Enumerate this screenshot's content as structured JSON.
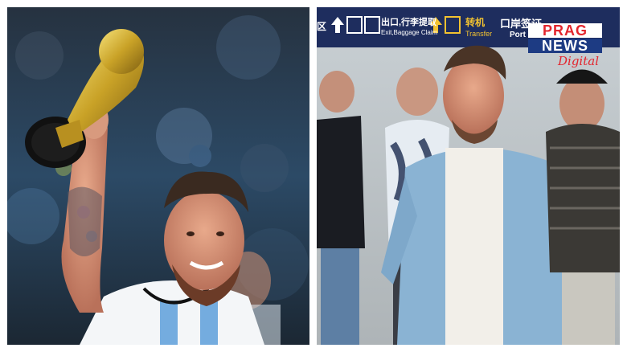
{
  "left_photo": {
    "subject": "player-raising-trophy"
  },
  "right_photo": {
    "signage": {
      "exit_label_cn": "出口,行李提取",
      "exit_label_en": "Exit,Baggage Claim",
      "transfer_label_cn": "转机",
      "transfer_label_en": "Transfer",
      "port_label_cn": "口岸签证",
      "port_label_en": "Port Visa",
      "left_edge_label": "区"
    }
  },
  "watermark": {
    "line1": "PRAG",
    "line2": "NEWS",
    "line3": "Digital",
    "colors": {
      "red": "#e3262e",
      "blue": "#1d3b83"
    }
  }
}
